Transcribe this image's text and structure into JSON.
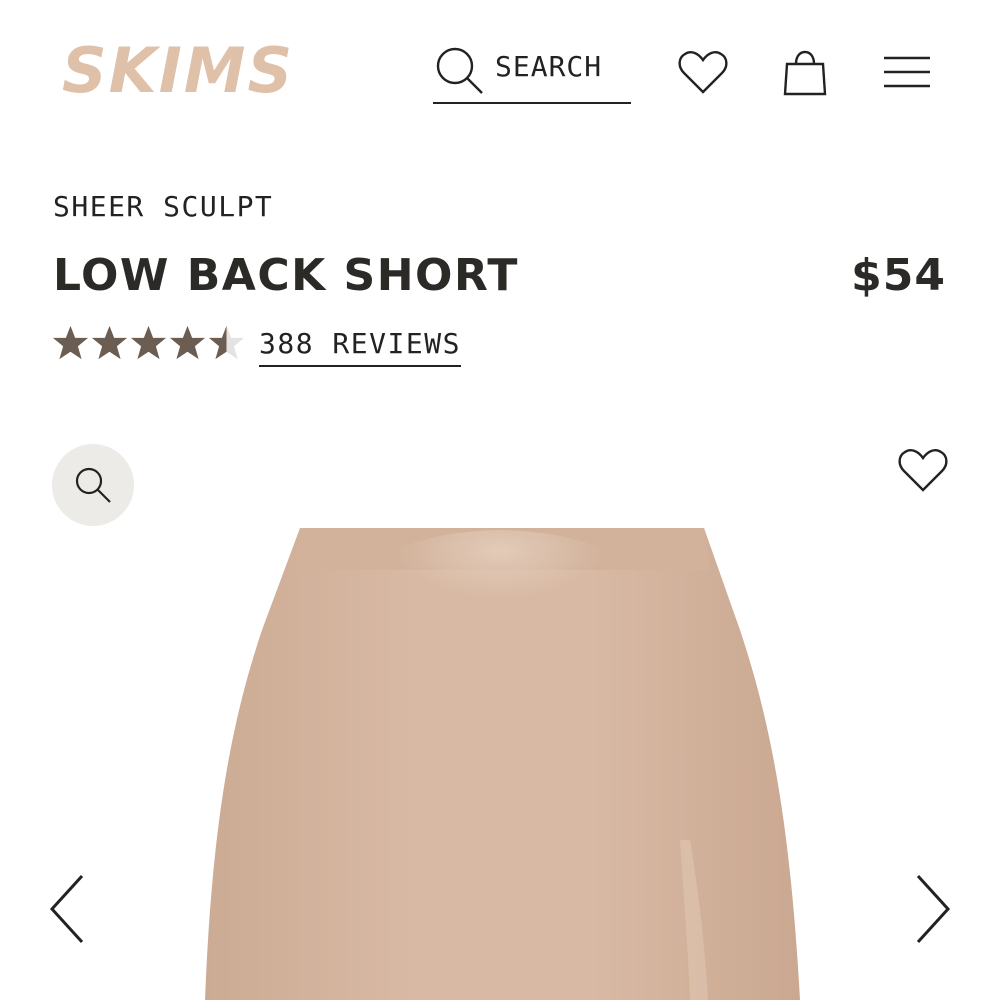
{
  "header": {
    "logo_text": "SKIMS",
    "search_label": "SEARCH",
    "icons": [
      "search-icon",
      "heart-icon",
      "shopping-bag-icon",
      "menu-icon"
    ]
  },
  "product": {
    "collection": "SHEER SCULPT",
    "title": "LOW BACK SHORT",
    "price": "$54",
    "rating": 4.5,
    "rating_max": 5,
    "reviews_label": "388 REVIEWS"
  },
  "gallery": {
    "icons": [
      "zoom-icon",
      "heart-icon",
      "chevron-left-icon",
      "chevron-right-icon"
    ]
  },
  "colors": {
    "logo": "#dfc0a8",
    "text": "#2b2a27",
    "star_filled": "#6b5d52",
    "star_empty": "#e4e3e1",
    "zoom_bg": "#ecebe8",
    "product": "#d6b59e"
  }
}
